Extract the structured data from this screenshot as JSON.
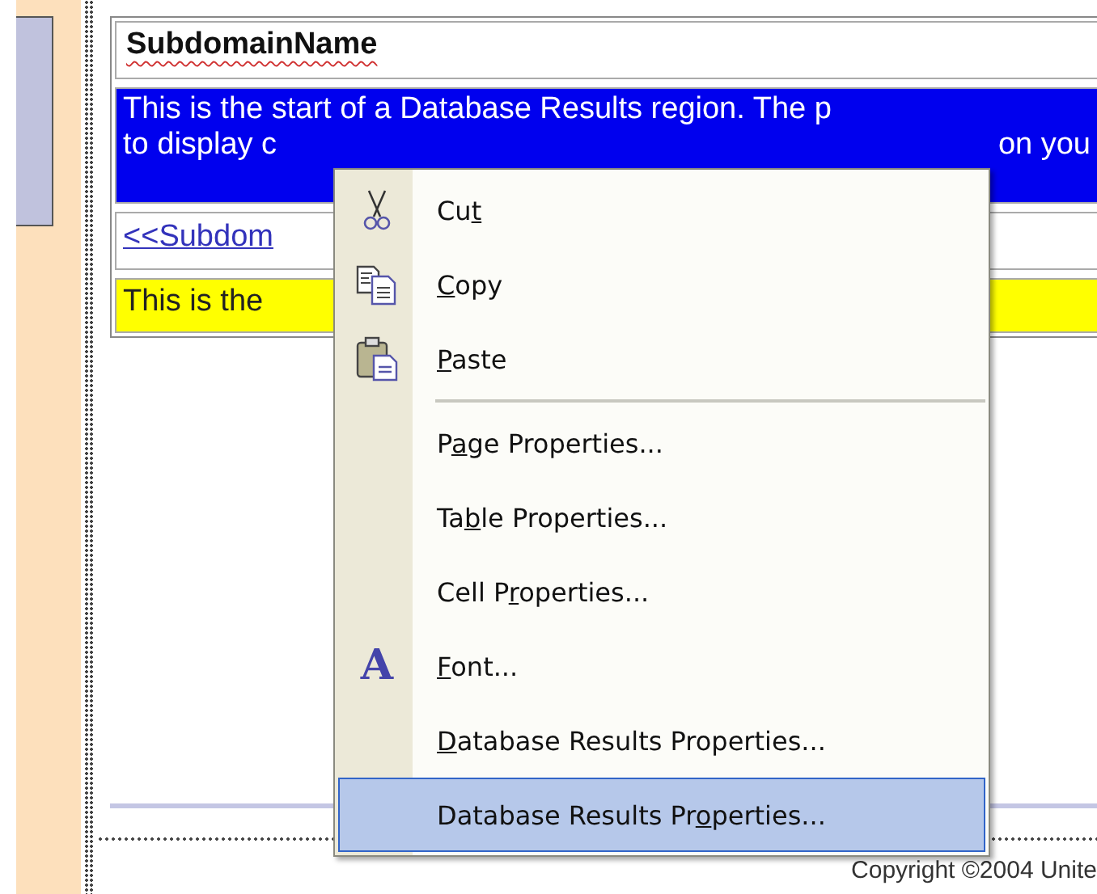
{
  "design_view": {
    "header": {
      "text": "SubdomainName",
      "misspelled": true
    },
    "region_notice": {
      "line_1": "This is the start of a Database Results region. The p",
      "line_2_left": "to display c",
      "line_2_right": "on you"
    },
    "field_link": "<<Subdom",
    "end_notice": "This is the",
    "footer": "Copyright ©2004 Unite"
  },
  "context_menu": {
    "items": [
      {
        "kind": "cut",
        "before": "Cu",
        "key": "t",
        "separator_before": false,
        "selected": false
      },
      {
        "kind": "copy",
        "key": "C",
        "after": "opy",
        "separator_before": false,
        "selected": false
      },
      {
        "kind": "paste",
        "key": "P",
        "after": "aste",
        "separator_before": false,
        "selected": false
      },
      {
        "kind": "command",
        "before": "P",
        "key": "a",
        "after": "ge Properties...",
        "separator_before": true,
        "selected": false
      },
      {
        "kind": "command",
        "before": "Ta",
        "key": "b",
        "after": "le Properties...",
        "separator_before": false,
        "selected": false
      },
      {
        "kind": "command",
        "before": "Cell P",
        "key": "r",
        "after": "operties...",
        "separator_before": false,
        "selected": false
      },
      {
        "kind": "font",
        "icon_text": "A",
        "key": "F",
        "after": "ont...",
        "separator_before": false,
        "selected": false
      },
      {
        "kind": "command",
        "key": "D",
        "after": "atabase Results Properties...",
        "separator_before": false,
        "selected": false
      },
      {
        "kind": "command",
        "before": "Database Results Pr",
        "key": "o",
        "after": "perties...",
        "separator_before": false,
        "selected": true
      }
    ]
  }
}
